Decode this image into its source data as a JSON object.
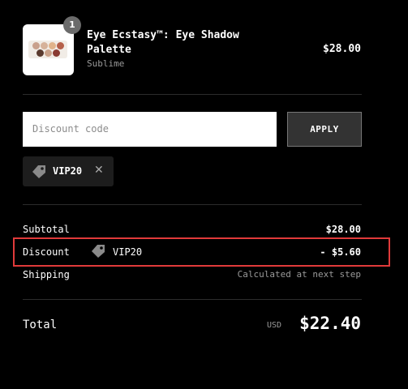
{
  "cart": {
    "item": {
      "quantity": "1",
      "name": "Eye Ecstasy™: Eye Shadow Palette",
      "brand": "Sublime",
      "price": "$28.00",
      "thumbnail_icon": "eyeshadow-palette-image"
    }
  },
  "discount_form": {
    "placeholder": "Discount code",
    "value": "",
    "apply_label": "APPLY"
  },
  "applied_code": {
    "code": "VIP20",
    "icon": "tag-icon",
    "remove_icon": "close-icon"
  },
  "summary": {
    "subtotal_label": "Subtotal",
    "subtotal_value": "$28.00",
    "discount_label": "Discount",
    "discount_code": "VIP20",
    "discount_value": "- $5.60",
    "shipping_label": "Shipping",
    "shipping_value": "Calculated at next step",
    "total_label": "Total",
    "currency": "USD",
    "total_value": "$22.40"
  },
  "colors": {
    "background": "#000000",
    "highlight_border": "#e03a3a",
    "apply_bg": "#333333"
  }
}
